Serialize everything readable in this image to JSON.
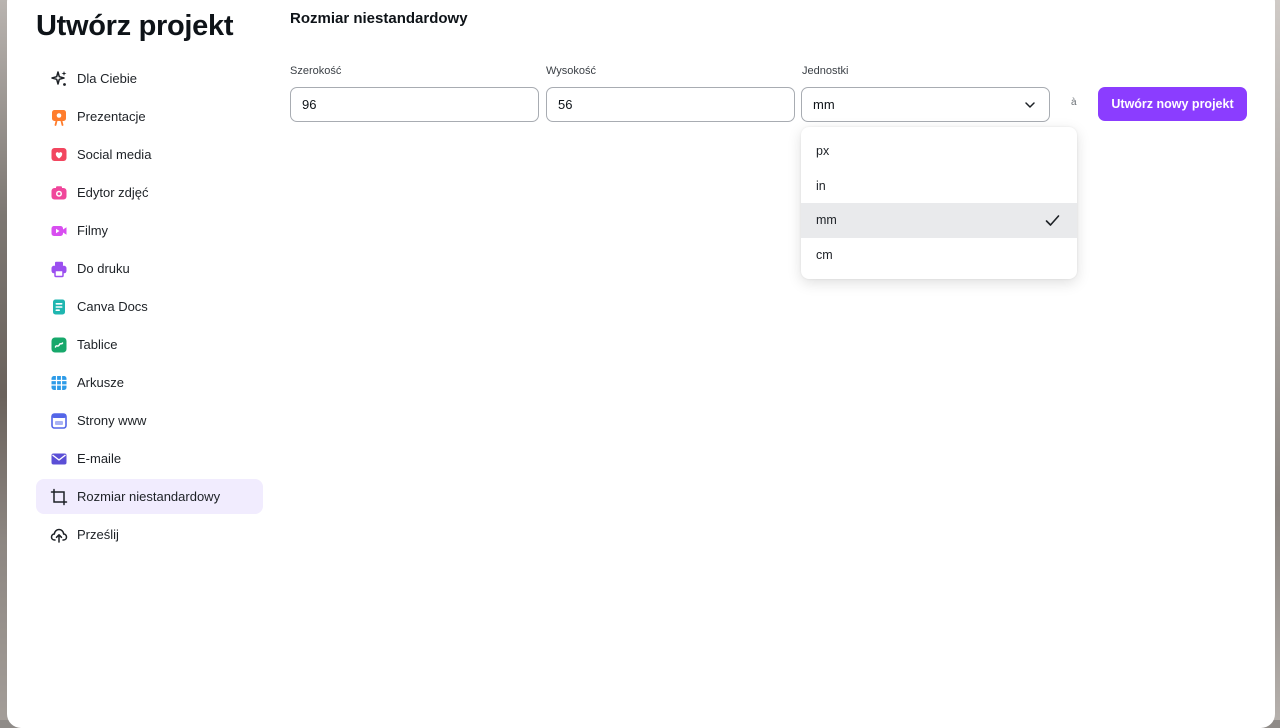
{
  "modal": {
    "title": "Utwórz projekt",
    "section_title": "Rozmiar niestandardowy"
  },
  "sidebar": {
    "items": [
      {
        "label": "Dla Ciebie",
        "icon": "sparkle-icon",
        "color": "#1d2126"
      },
      {
        "label": "Prezentacje",
        "icon": "presentation-icon",
        "color": "#ff7d2d"
      },
      {
        "label": "Social media",
        "icon": "heart-icon",
        "color": "#f2465f"
      },
      {
        "label": "Edytor zdjęć",
        "icon": "camera-icon",
        "color": "#f0469b"
      },
      {
        "label": "Filmy",
        "icon": "video-icon",
        "color": "#d84ef0"
      },
      {
        "label": "Do druku",
        "icon": "printer-icon",
        "color": "#9b4ff0"
      },
      {
        "label": "Canva Docs",
        "icon": "doc-icon",
        "color": "#1fb6b0"
      },
      {
        "label": "Tablice",
        "icon": "whiteboard-icon",
        "color": "#17a86b"
      },
      {
        "label": "Arkusze",
        "icon": "sheet-icon",
        "color": "#2d9be8"
      },
      {
        "label": "Strony www",
        "icon": "website-icon",
        "color": "#5466e8"
      },
      {
        "label": "E-maile",
        "icon": "email-icon",
        "color": "#5b4fd6"
      },
      {
        "label": "Rozmiar niestandardowy",
        "icon": "custom-size-icon",
        "color": "#1d2126"
      },
      {
        "label": "Prześlij",
        "icon": "upload-cloud-icon",
        "color": "#1d2126"
      }
    ],
    "active_index": 11
  },
  "form": {
    "width_label": "Szerokość",
    "width_value": "96",
    "height_label": "Wysokość",
    "height_value": "56",
    "units_label": "Jednostki",
    "units_value": "mm",
    "swap_char": "à",
    "create_button": "Utwórz nowy projekt"
  },
  "dropdown": {
    "options": [
      "px",
      "in",
      "mm",
      "cm"
    ],
    "selected": "mm"
  },
  "colors": {
    "accent": "#8b3dff",
    "active_bg": "#f1ecfe"
  }
}
